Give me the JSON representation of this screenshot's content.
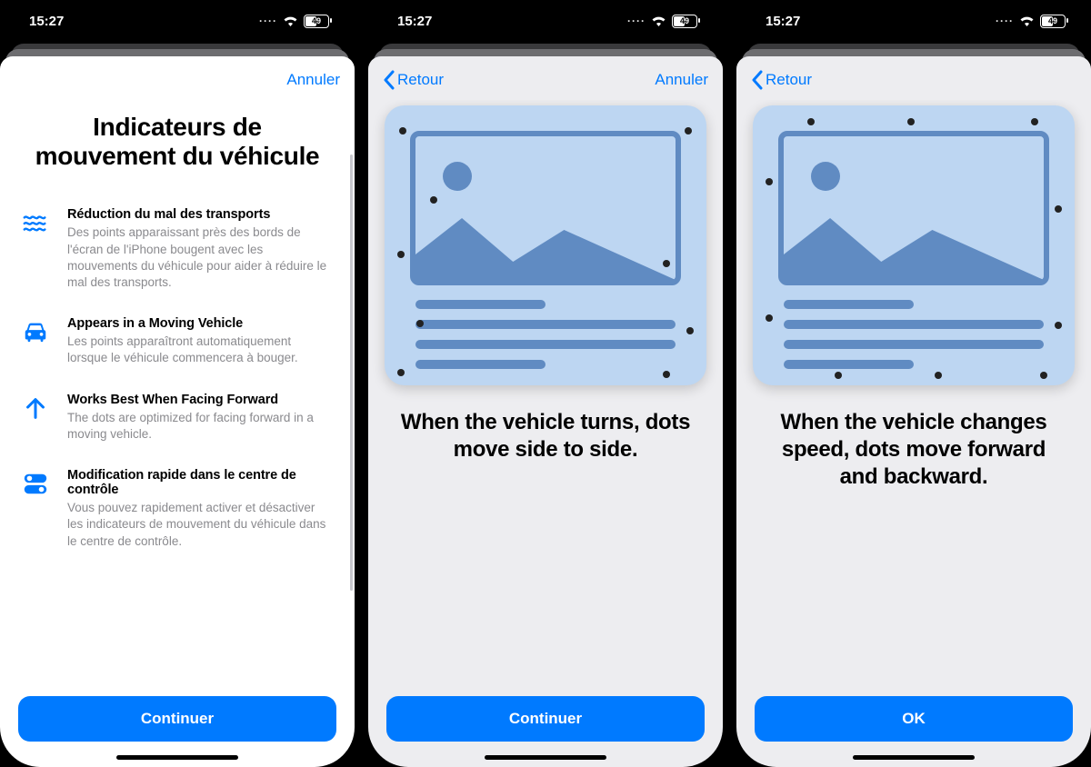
{
  "status_bar": {
    "time": "15:27",
    "battery": "49"
  },
  "screen1": {
    "cancel": "Annuler",
    "title": "Indicateurs de mouvement du véhicule",
    "features": [
      {
        "icon": "waves-icon",
        "title": "Réduction du mal des transports",
        "desc": "Des points apparaissant près des bords de l'écran de l'iPhone bougent avec les mouvements du véhicule pour aider à réduire le mal des transports."
      },
      {
        "icon": "car-icon",
        "title": "Appears in a Moving Vehicle",
        "desc": "Les points apparaîtront automatiquement lorsque le véhicule commencera à bouger."
      },
      {
        "icon": "arrow-up-icon",
        "title": "Works Best When Facing Forward",
        "desc": "The dots are optimized for facing forward in a moving vehicle."
      },
      {
        "icon": "toggle-icon",
        "title": "Modification rapide dans le centre de contrôle",
        "desc": "Vous pouvez rapidement activer et désactiver les indicateurs de mouvement du véhicule dans le centre de contrôle."
      }
    ],
    "button": "Continuer"
  },
  "screen2": {
    "back": "Retour",
    "cancel": "Annuler",
    "text": "When the vehicle turns, dots move side to side.",
    "button": "Continuer"
  },
  "screen3": {
    "back": "Retour",
    "text": "When the vehicle changes speed, dots move forward and backward.",
    "button": "OK"
  }
}
